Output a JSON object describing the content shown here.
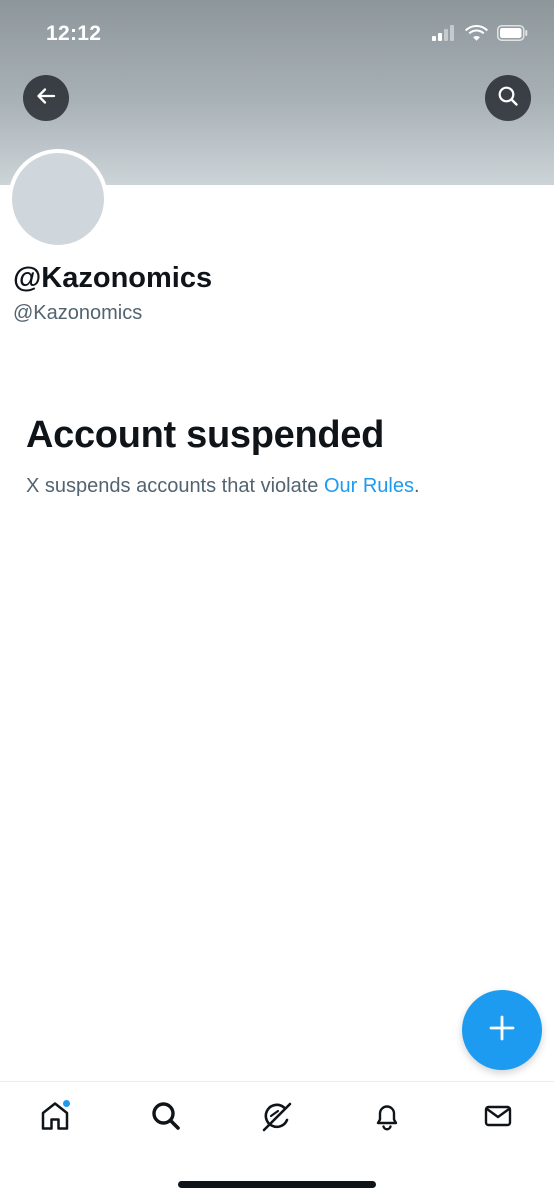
{
  "status_bar": {
    "time": "12:12",
    "icons": [
      "cellular-signal-icon",
      "wifi-icon",
      "battery-icon"
    ]
  },
  "header": {
    "back_icon": "arrow-left-icon",
    "search_icon": "search-icon"
  },
  "profile": {
    "display_name": "@Kazonomics",
    "handle": "@Kazonomics"
  },
  "notice": {
    "title": "Account suspended",
    "text_before": "X suspends accounts that violate ",
    "link_text": "Our Rules",
    "text_after": "."
  },
  "fab": {
    "icon": "plus-icon"
  },
  "tab_bar": {
    "items": [
      {
        "icon": "home-icon",
        "has_notification_dot": true
      },
      {
        "icon": "search-icon"
      },
      {
        "icon": "grok-icon"
      },
      {
        "icon": "bell-icon"
      },
      {
        "icon": "mail-icon"
      }
    ]
  },
  "colors": {
    "accent": "#1d9bf0",
    "text_primary": "#0f1419",
    "text_secondary": "#536471",
    "avatar_placeholder": "#d0d7dc"
  }
}
